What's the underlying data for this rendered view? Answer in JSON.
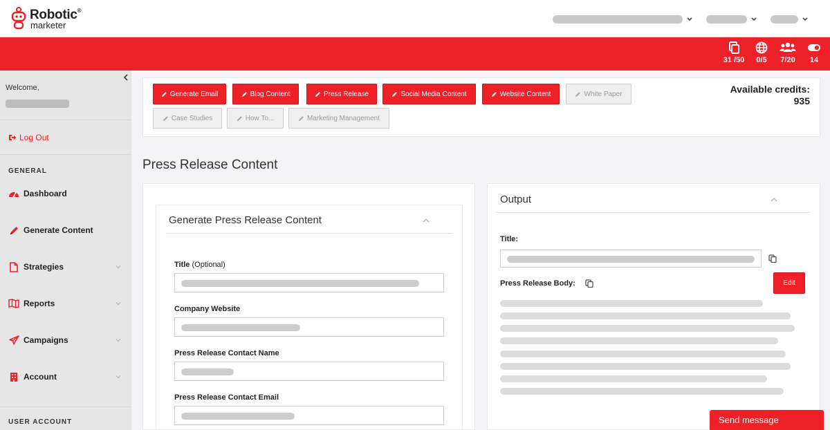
{
  "brand": {
    "name_line1": "Robotic",
    "name_line2": "marketer",
    "registered": "®"
  },
  "header_stats": [
    {
      "icon": "copy-icon",
      "value": "31 /50"
    },
    {
      "icon": "globe-icon",
      "value": "0/5"
    },
    {
      "icon": "users-icon",
      "value": "7/20"
    },
    {
      "icon": "toggle-icon",
      "value": "14"
    }
  ],
  "sidebar": {
    "welcome": "Welcome,",
    "logout": "Log Out",
    "general_label": "GENERAL",
    "items": [
      {
        "label": "Dashboard",
        "icon": "dashboard-icon"
      },
      {
        "label": "Generate Content",
        "icon": "pencil-icon"
      },
      {
        "label": "Strategies",
        "icon": "file-icon"
      },
      {
        "label": "Reports",
        "icon": "map-icon"
      },
      {
        "label": "Campaigns",
        "icon": "send-icon"
      },
      {
        "label": "Account",
        "icon": "building-icon"
      }
    ],
    "user_account_label": "USER ACCOUNT"
  },
  "content_buttons": [
    {
      "label": "Generate Email",
      "active": true
    },
    {
      "label": "Blog Content",
      "active": true
    },
    {
      "label": "Press Release",
      "active": true
    },
    {
      "label": "Social Media Content",
      "active": true
    },
    {
      "label": "Website Content",
      "active": true
    },
    {
      "label": "White Paper",
      "active": false
    },
    {
      "label": "Case Studies",
      "active": false
    },
    {
      "label": "How To...",
      "active": false
    },
    {
      "label": "Marketing Management",
      "active": false
    }
  ],
  "credits": {
    "label": "Available credits:",
    "value": "935"
  },
  "page_title": "Press Release Content",
  "form": {
    "heading": "Generate Press Release Content",
    "fields": [
      {
        "label": "Title",
        "optional": "(Optional)"
      },
      {
        "label": "Company Website",
        "optional": ""
      },
      {
        "label": "Press Release Contact Name",
        "optional": ""
      },
      {
        "label": "Press Release Contact Email",
        "optional": ""
      }
    ]
  },
  "output": {
    "heading": "Output",
    "title_label": "Title:",
    "body_label": "Press Release Body:",
    "edit_label": "Edit"
  },
  "chat": {
    "send_label": "Send message"
  },
  "colors": {
    "accent": "#ee2028",
    "sidebar_bg": "#e6e6e6",
    "placeholder_bar": "#cdcdcd"
  }
}
